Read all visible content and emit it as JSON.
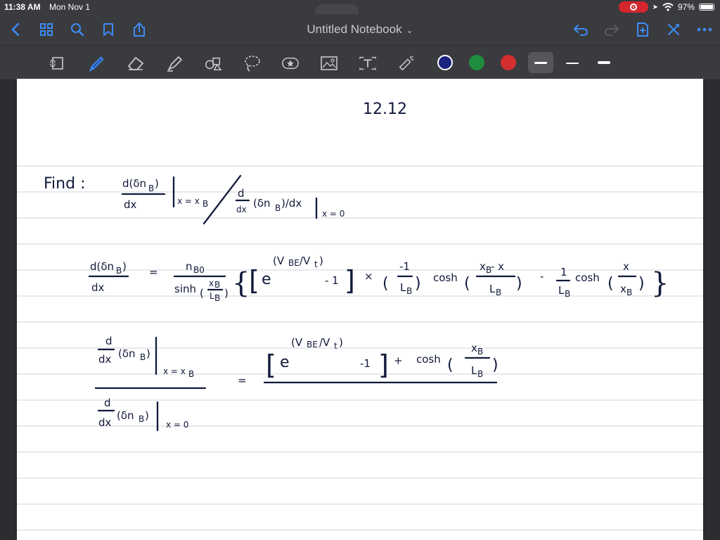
{
  "status_bar": {
    "time": "11:38 AM",
    "date": "Mon Nov 1",
    "battery": "97%"
  },
  "nav": {
    "title": "Untitled Notebook",
    "accent_color": "#3d8cf5"
  },
  "toolbar": {
    "tools": [
      "lasso-page-icon",
      "pen-icon",
      "eraser-icon",
      "highlighter-icon",
      "shapes-icon",
      "lasso-icon",
      "sticker-icon",
      "image-icon",
      "text-icon",
      "laser-pointer-icon"
    ],
    "colors": [
      "#1a237e",
      "#1e8e3e",
      "#d32f2f"
    ]
  },
  "notes": {
    "heading": "12.12",
    "find": {
      "label": "Find :",
      "num": "d(δn",
      "num_sub": "B",
      "num_close": ")",
      "den": "dx",
      "eval1": "x = x",
      "eval1_sub": "B",
      "slash": "/",
      "d2": "d",
      "dx2": "dx",
      "expr2": "(δn",
      "expr2_sub": "B",
      "expr2_tail": ")/dx",
      "eval2": "x = 0"
    },
    "deriv": {
      "lhs_num": "d(δn",
      "lhs_sub": "B",
      "lhs_close": ")",
      "lhs_den": "dx",
      "equals": "=",
      "coef_num": "n",
      "coef_num_sub": "B0",
      "coef_den": "sinh",
      "coef_den_frac_num": "x",
      "coef_den_frac_num_sub": "B",
      "coef_den_frac_den": "L",
      "coef_den_frac_den_sub": "B",
      "e": "e",
      "exponent": "(V",
      "exponent_sub": "BE",
      "exponent_tail": "/V",
      "exponent_tail_sub": "t",
      "exponent_close": ")",
      "minus_one": "- 1",
      "times": "×",
      "frac1_num": "-1",
      "frac1_den": "L",
      "frac1_den_sub": "B",
      "cosh1": "cosh",
      "frac2_num": "x",
      "frac2_num_sub": "B",
      "frac2_num_tail": " - x",
      "frac2_den": "L",
      "frac2_den_sub": "B",
      "minus": "-",
      "frac3_num": "1",
      "frac3_den": "L",
      "frac3_den_sub": "B",
      "cosh2": "cosh",
      "frac4_num": "x",
      "frac4_den": "x",
      "frac4_den_sub": "B"
    },
    "ratio": {
      "top_d": "d",
      "top_dx": "dx",
      "top_expr": "(δn",
      "top_sub": "B",
      "top_close": ")",
      "top_eval": "x = x",
      "top_eval_sub": "B",
      "bot_d": "d",
      "bot_dx": "dx",
      "bot_expr": "(δn",
      "bot_sub": "B",
      "bot_close": ")",
      "bot_eval": "x = 0",
      "equals": "=",
      "e": "e",
      "exponent": "(V",
      "exponent_sub": "BE",
      "exponent_tail": "/V",
      "exponent_tail_sub": "t",
      "exponent_close": ")",
      "minus_one": "-1",
      "plus": "+",
      "cosh": "cosh",
      "frac_num": "x",
      "frac_num_sub": "B",
      "frac_den": "L",
      "frac_den_sub": "B"
    }
  }
}
